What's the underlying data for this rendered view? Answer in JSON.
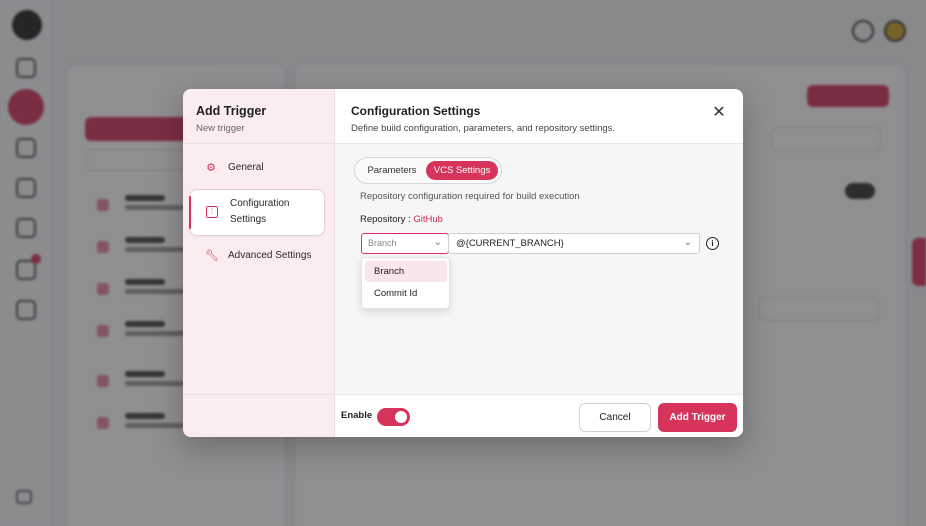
{
  "modal": {
    "title": "Add Trigger",
    "subtitle": "New trigger",
    "nav": [
      {
        "label": "General",
        "icon": "gear-icon"
      },
      {
        "label": "Configuration Settings",
        "icon": "config-icon"
      },
      {
        "label": "Advanced Settings",
        "icon": "wrench-icon"
      }
    ],
    "active_nav": "Configuration Settings"
  },
  "config": {
    "title": "Configuration Settings",
    "description": "Define build configuration, parameters, and repository settings.",
    "tabs": [
      {
        "label": "Parameters"
      },
      {
        "label": "VCS Settings"
      }
    ],
    "active_tab": "VCS Settings",
    "repo_description": "Repository configuration required for build execution",
    "repo_label": "Repository : ",
    "repo_name": "GitHub",
    "ref_type": {
      "placeholder": "Branch",
      "options": [
        "Branch",
        "Commit Id"
      ],
      "highlighted": "Branch"
    },
    "branch_value": "@{CURRENT_BRANCH}"
  },
  "footer": {
    "enable_label": "Enable",
    "enabled": true,
    "cancel_label": "Cancel",
    "submit_label": "Add Trigger"
  },
  "colors": {
    "accent": "#d6345a",
    "sidebar_bg": "#fbecf0",
    "overlay": "rgba(40,40,45,0.52)"
  }
}
